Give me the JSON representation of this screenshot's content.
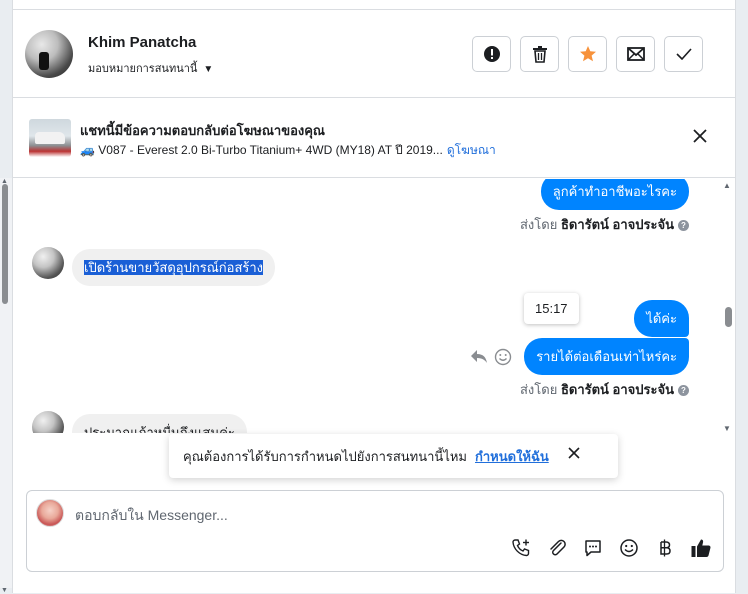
{
  "header": {
    "name": "Khim Panatcha",
    "assign_label": "มอบหมายการสนทนานี้",
    "actions": [
      {
        "icon": "alert-icon"
      },
      {
        "icon": "trash-icon"
      },
      {
        "icon": "star-icon",
        "color": "#f7923b"
      },
      {
        "icon": "mail-icon"
      },
      {
        "icon": "check-icon"
      }
    ]
  },
  "ad": {
    "title": "แชทนี้มีข้อความตอบกลับต่อโฆษณาของคุณ",
    "description": "🚙 V087 - Everest 2.0 Bi-Turbo Titanium+ 4WD (MY18) AT ปี 2019...",
    "link": "ดูโฆษณา"
  },
  "messages": {
    "out1": "ลูกค้าทำอาชีพอะไรคะ",
    "sent_by_label": "ส่งโดย",
    "sender_name": "ธิดารัตน์ อาจประจัน",
    "in1": "เปิดร้านขายวัสดุอุปกรณ์ก่อสร้าง",
    "out2": "ได้ค่ะ",
    "out3": "รายได้ต่อเดือนเท่าไหร่คะ",
    "tooltip_time": "15:17",
    "in2": "ประมาณเก้าหมื่นถึงแสนค่ะ"
  },
  "toast": {
    "text": "คุณต้องการได้รับการกำหนดไปยังการสนทนานี้ไหม",
    "link": "กำหนดให้ฉัน"
  },
  "composer": {
    "placeholder": "ตอบกลับใน Messenger...",
    "tools": [
      "phone-plus-icon",
      "paperclip-icon",
      "speech-bubble-icon",
      "emoji-icon",
      "baht-icon",
      "thumbs-up-icon"
    ]
  },
  "colors": {
    "accent": "#0084ff",
    "link": "#216fdb",
    "star": "#f7923b"
  }
}
